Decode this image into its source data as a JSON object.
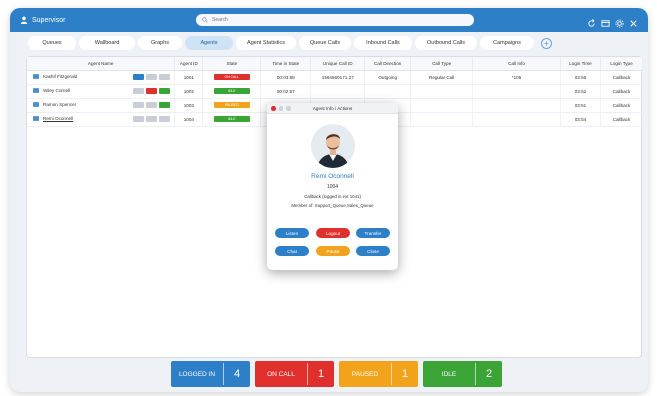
{
  "app": {
    "title": "Supervisor",
    "search_placeholder": "Search"
  },
  "tabs": [
    "Queues",
    "Wallboard",
    "Graphs",
    "Agents",
    "Agent Statistics",
    "Queue Calls",
    "Inbound Calls",
    "Outbound Calls",
    "Campaigns"
  ],
  "active_tab": "Agents",
  "table": {
    "headers": [
      "Agent Name",
      "Agent ID",
      "State",
      "Time in State",
      "Unique Call ID",
      "Call Direction",
      "Call Type",
      "Call Info",
      "Login Time",
      "Login Type"
    ],
    "rows": [
      {
        "name": "Kashif Fitzgerald",
        "id": "1001",
        "state": "ON CALL",
        "time": "00:03:58",
        "call_id": "1564560171.27",
        "direction": "Outgoing",
        "type": "Regular Call",
        "info": "*105",
        "login": "03:56",
        "login_type": "Callback"
      },
      {
        "name": "Wiley Cornell",
        "id": "1002",
        "state": "IDLE",
        "time": "00:02:57",
        "call_id": "",
        "direction": "",
        "type": "",
        "info": "",
        "login": "03:52",
        "login_type": "Callback"
      },
      {
        "name": "Ramon Spencer",
        "id": "1003",
        "state": "PAUSED",
        "time": "00:0",
        "call_id": "",
        "direction": "",
        "type": "",
        "info": "",
        "login": "03:51",
        "login_type": "Callback"
      },
      {
        "name": "Remi Oconnell",
        "id": "1004",
        "state": "IDLE",
        "time": "00:0",
        "call_id": "",
        "direction": "",
        "type": "",
        "info": "",
        "login": "03:54",
        "login_type": "Callback"
      }
    ]
  },
  "modal": {
    "title": "Agent Info / Actions",
    "name": "Remi Oconnell",
    "id": "1004",
    "status": "Callback (logged in ext 1041)",
    "member": "Member of: Support_Queue,Sales_Queue",
    "buttons": [
      "Listen",
      "Logout",
      "Transfer",
      "Chat",
      "Pause",
      "Close"
    ]
  },
  "status_bar": [
    {
      "label": "LOGGED IN",
      "count": "4",
      "color": "#2d7fc7"
    },
    {
      "label": "ON CALL",
      "count": "1",
      "color": "#e0302e"
    },
    {
      "label": "PAUSED",
      "count": "1",
      "color": "#f2a31c"
    },
    {
      "label": "IDLE",
      "count": "2",
      "color": "#3aa536"
    }
  ],
  "colors": {
    "brand": "#2d7fc7",
    "on_call": "#e0302e",
    "paused": "#f2a31c",
    "idle": "#3aa536"
  }
}
